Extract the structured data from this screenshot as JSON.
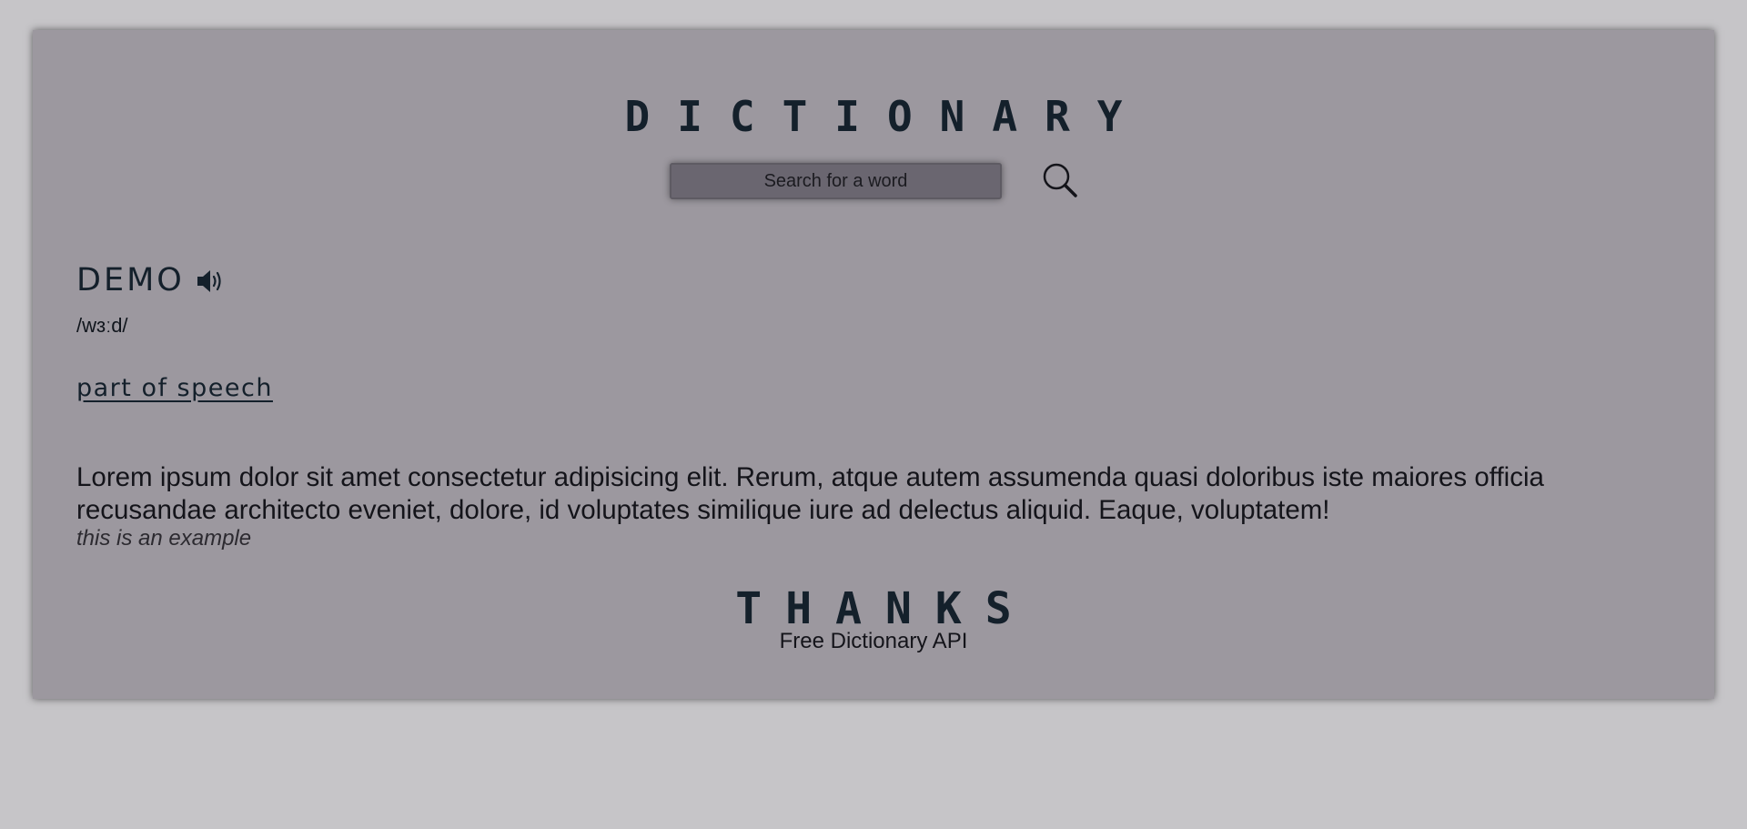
{
  "header": {
    "title": "DICTIONARY"
  },
  "search": {
    "placeholder": "Search for a word",
    "icon": "search-icon"
  },
  "entry": {
    "word": "DEMO",
    "audio_icon": "speaker-icon",
    "phonetic": "/wɜːd/",
    "part_of_speech": "part of speech",
    "definition": "Lorem ipsum dolor sit amet consectetur adipisicing elit. Rerum, atque autem assumenda quasi doloribus iste maiores officia recusandae architecto eveniet, dolore, id voluptates similique iure ad delectus aliquid. Eaque, voluptatem!",
    "example": "this is an example"
  },
  "footer": {
    "thanks": "THANKS",
    "credit": "Free Dictionary API"
  },
  "colors": {
    "page_background": "#c6c5c8",
    "card_background": "#9c989f",
    "heading_text": "#14202b",
    "input_background": "#6a6670"
  }
}
